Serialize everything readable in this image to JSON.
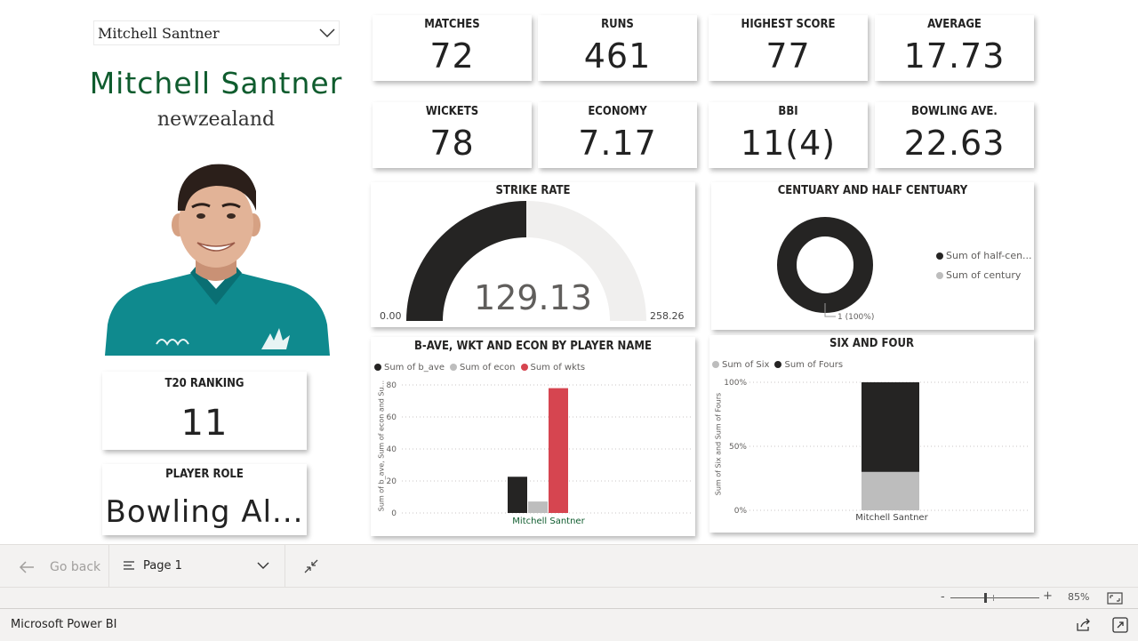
{
  "slicer": {
    "selected": "Mitchell Santner"
  },
  "player": {
    "name": "Mitchell Santner",
    "country": "newzealand"
  },
  "kpis": [
    {
      "title": "MATCHES",
      "value": "72"
    },
    {
      "title": "RUNS",
      "value": "461"
    },
    {
      "title": "HIGHEST SCORE",
      "value": "77"
    },
    {
      "title": "AVERAGE",
      "value": "17.73"
    },
    {
      "title": "WICKETS",
      "value": "78"
    },
    {
      "title": "ECONOMY",
      "value": "7.17"
    },
    {
      "title": "BBI",
      "value": "11(4)"
    },
    {
      "title": "BOWLING AVE.",
      "value": "22.63"
    }
  ],
  "ranking": {
    "title": "T20 RANKING",
    "value": "11"
  },
  "role": {
    "title": "PLAYER ROLE",
    "value": "Bowling Al..."
  },
  "gauge": {
    "title": "STRIKE RATE",
    "value": "129.13",
    "min": "0.00",
    "max": "258.26",
    "fraction": 0.5,
    "fill_color": "#252423",
    "track_color": "#f0efee"
  },
  "donut": {
    "title": "CENTUARY AND HALF CENTUARY",
    "legend": [
      "Sum of half-cen...",
      "Sum of century"
    ],
    "label": "1 (100%)",
    "colors": [
      "#252423",
      "#bdbdbd"
    ]
  },
  "chart_data": [
    {
      "type": "bar",
      "title": "B-AVE, WKT AND ECON BY PLAYER NAME",
      "categories": [
        "Mitchell Santner"
      ],
      "series": [
        {
          "name": "Sum of b_ave",
          "values": [
            22.63
          ],
          "color": "#252423"
        },
        {
          "name": "Sum of econ",
          "values": [
            7.17
          ],
          "color": "#bdbdbd"
        },
        {
          "name": "Sum of wkts",
          "values": [
            78
          ],
          "color": "#d64550"
        }
      ],
      "ylabel": "Sum of b_ave, Sum of econ and Su...",
      "ylim": [
        0,
        80
      ],
      "yticks": [
        "0",
        "20",
        "40",
        "60",
        "80"
      ],
      "grid": true,
      "legend_position": "top-left"
    },
    {
      "type": "bar",
      "title": "SIX AND FOUR",
      "categories": [
        "Mitchell Santner"
      ],
      "series": [
        {
          "name": "Sum of Six",
          "values": [
            0.3
          ],
          "color": "#bdbdbd"
        },
        {
          "name": "Sum of Fours",
          "values": [
            0.7
          ],
          "color": "#252423"
        }
      ],
      "ylabel": "Sum of Six and Sum of Fours",
      "ylim": [
        0,
        1
      ],
      "yticks": [
        "0%",
        "50%",
        "100%"
      ],
      "grid": true,
      "legend_position": "top-left"
    }
  ],
  "nav": {
    "back": "Go back",
    "page": "Page 1"
  },
  "status": {
    "zoom": "85%",
    "zoom_minus": "-",
    "zoom_plus": "+"
  },
  "app": {
    "title": "Microsoft Power BI"
  }
}
